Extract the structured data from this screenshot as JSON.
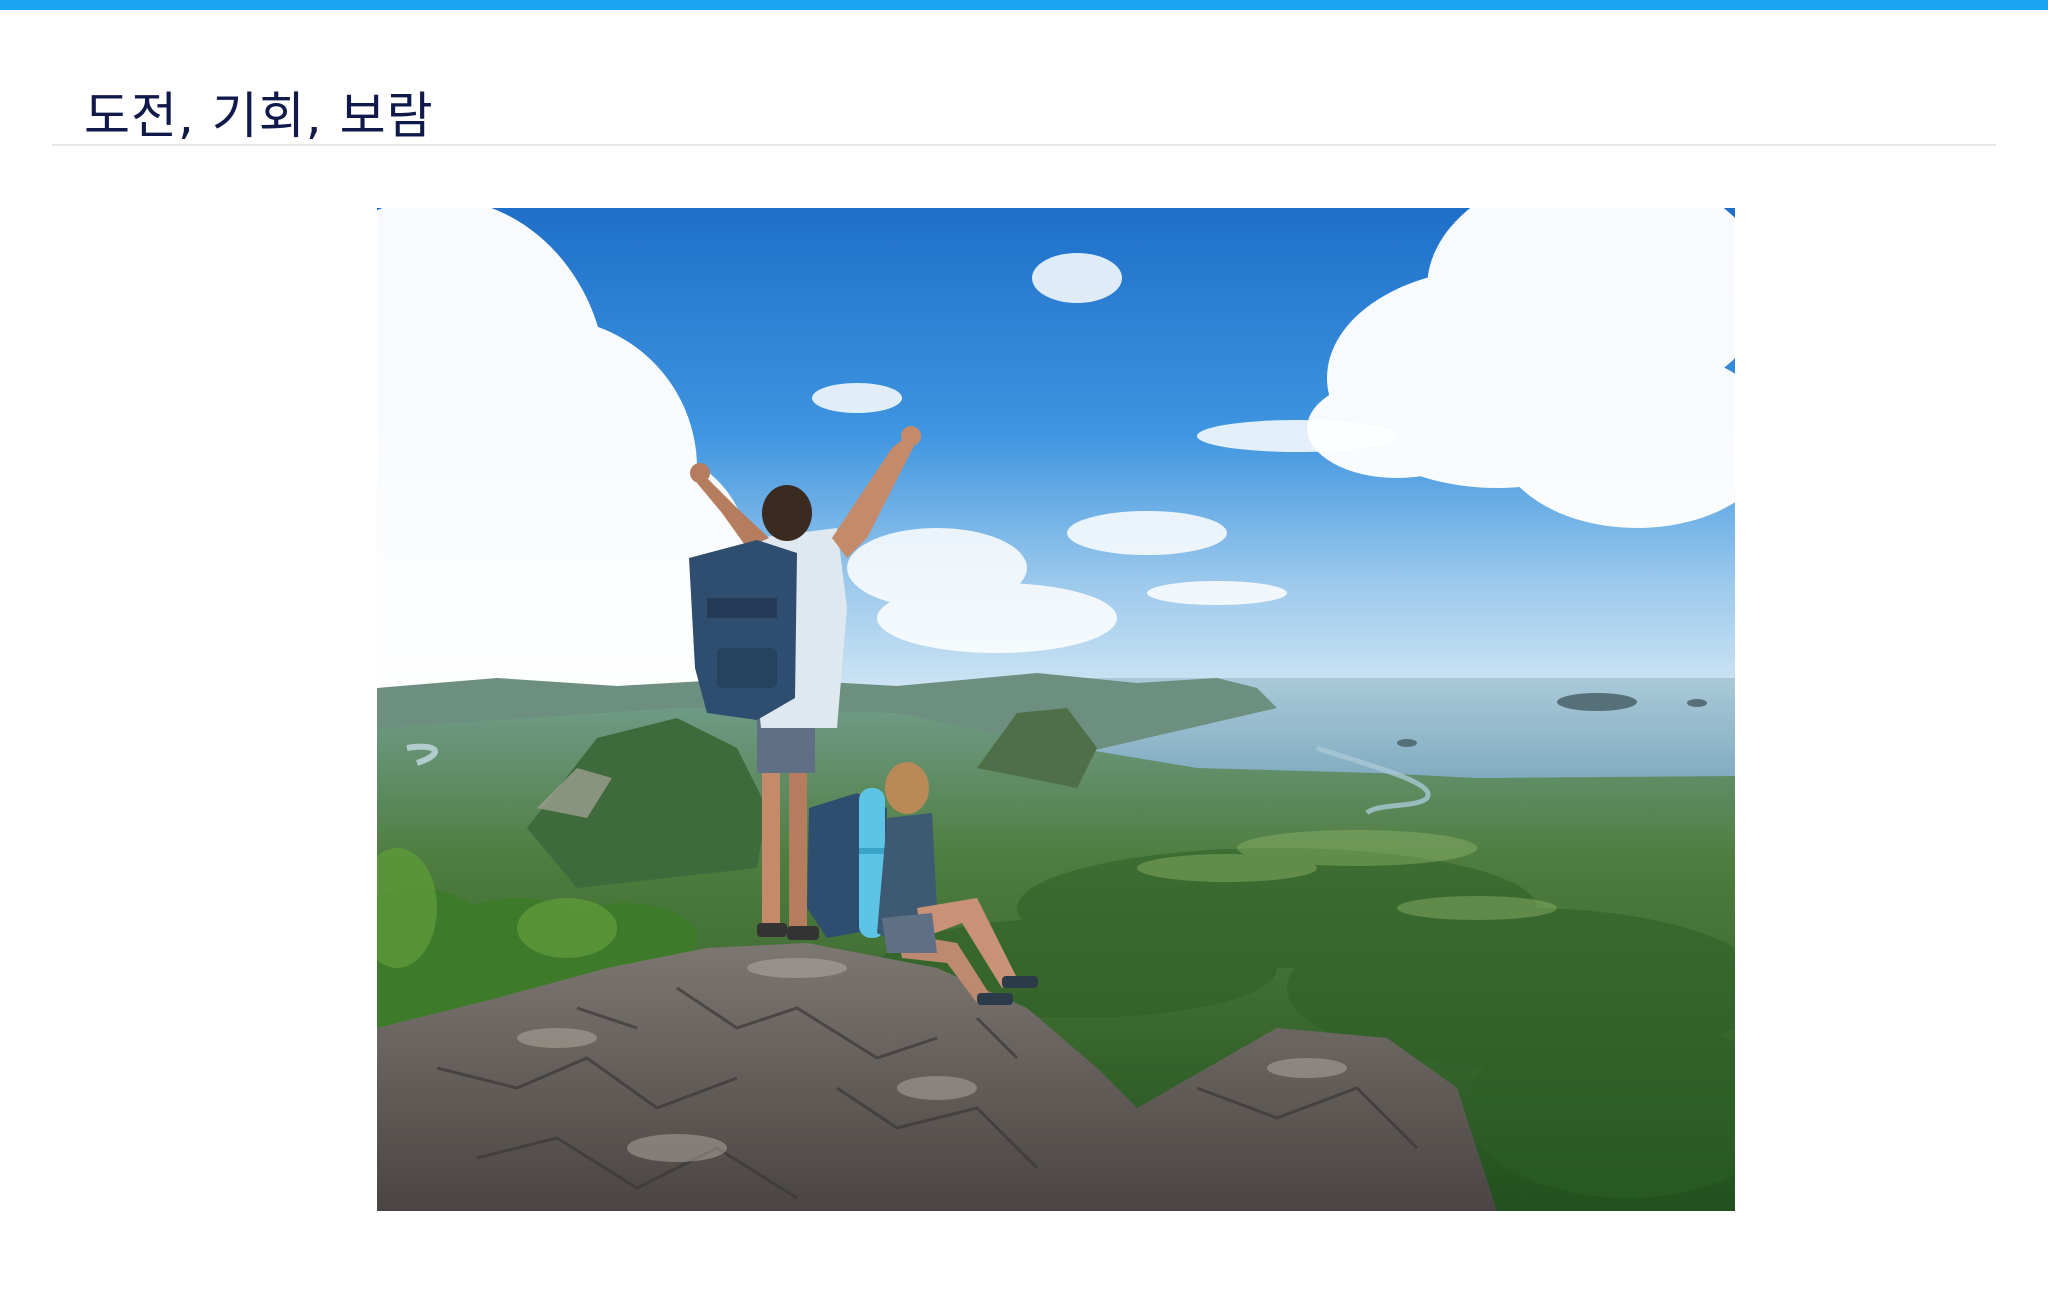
{
  "slide": {
    "title": "도전, 기회, 보람"
  },
  "theme": {
    "accent_bar": "#1aa3f0",
    "title_color": "#101a4a",
    "divider": "#e8e8e8"
  },
  "photo": {
    "icon": "hikers-on-mountain-summit-photo",
    "subject": "hikers-summit"
  }
}
